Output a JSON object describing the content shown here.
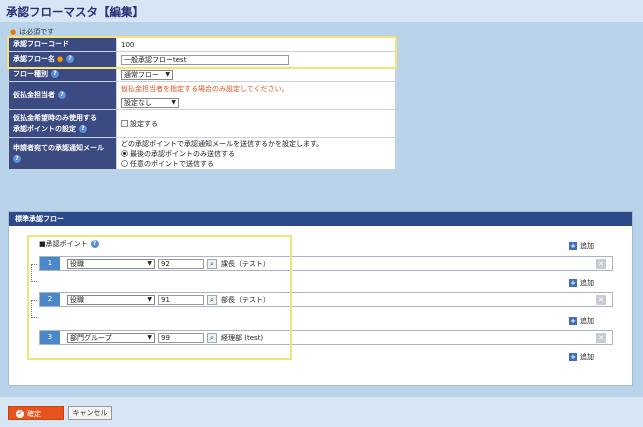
{
  "header": {
    "title": "承認フローマスタ【編集】"
  },
  "required_note": "は必須です",
  "form": {
    "flow_code": {
      "label": "承認フローコード",
      "value": "100"
    },
    "flow_name": {
      "label": "承認フロー名",
      "value": "一般承認フローtest"
    },
    "flow_type": {
      "label": "フロー種別",
      "selected": "通常フロー"
    },
    "payee": {
      "label": "仮払金担当者",
      "note": "仮払金担当者を指定する場合のみ設定してください。",
      "selected": "設定なし"
    },
    "advance_point": {
      "label_line1": "仮払金希望時のみ使用する",
      "label_line2": "承認ポイントの設定",
      "checkbox_label": "設定する"
    },
    "notify": {
      "label": "申請者宛ての承認通知メール",
      "description": "どの承認ポイントで承認通知メールを送信するかを設定します。",
      "option1": "最後の承認ポイントのみ送信する",
      "option2": "任意のポイントで送信する"
    }
  },
  "panel": {
    "title": "標準承認フロー",
    "points_label": "■承認ポイント",
    "add_label": "追加",
    "points": [
      {
        "num": "1",
        "type": "役職",
        "code": "92",
        "name": "課長（テスト）"
      },
      {
        "num": "2",
        "type": "役職",
        "code": "91",
        "name": "部長（テスト）"
      },
      {
        "num": "3",
        "type": "部門グループ",
        "code": "99",
        "name": "経理部 (test)"
      }
    ]
  },
  "buttons": {
    "ok": "確定",
    "cancel": "キャンセル"
  },
  "colors": {
    "header_bg": "#3c4a82",
    "accent": "#e9541e",
    "panel_head": "#2c4a8a",
    "highlight": "#f3e17a"
  }
}
